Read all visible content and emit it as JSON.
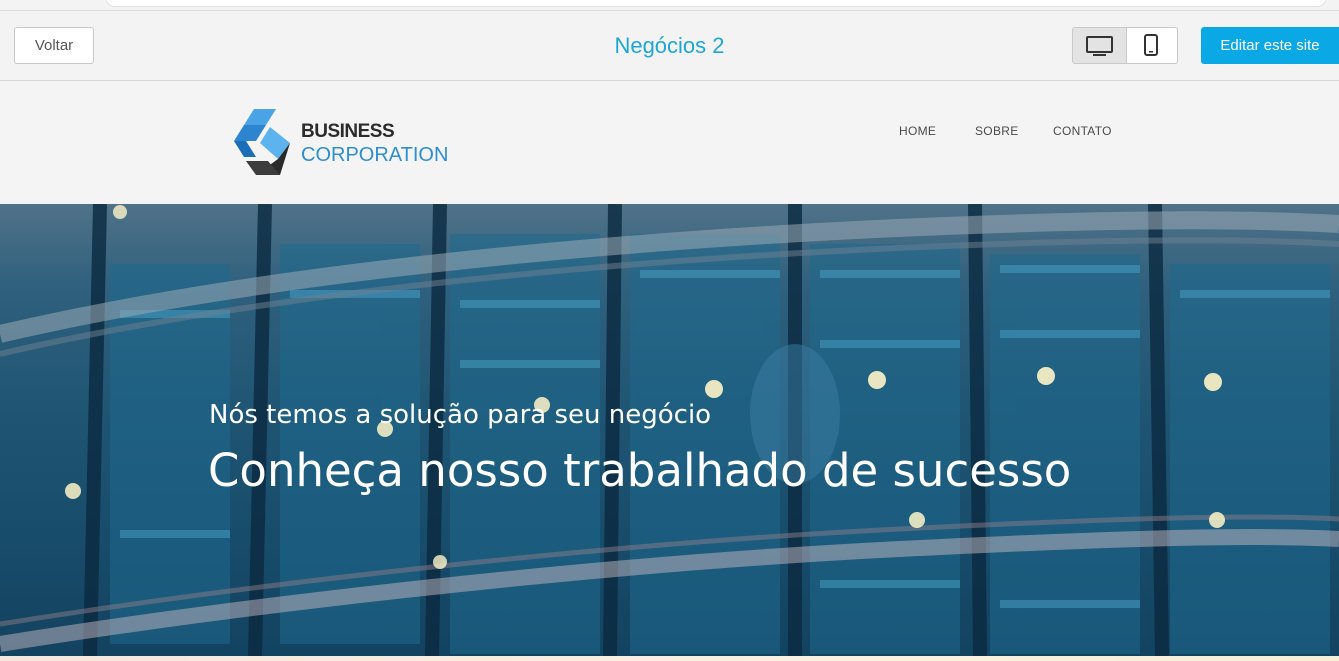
{
  "toolbar": {
    "back_label": "Voltar",
    "site_title": "Negócios 2",
    "devices": [
      "desktop-icon",
      "mobile-icon"
    ],
    "selected_device": "desktop",
    "edit_label": "Editar este site",
    "accent_color": "#1ea7d6",
    "button_color": "#0aa9e6"
  },
  "site": {
    "logo": {
      "line1": "BUSINESS",
      "line2": "CORPORATION"
    },
    "nav": [
      "HOME",
      "SOBRE",
      "CONTATO"
    ]
  },
  "hero": {
    "subtitle": "Nós temos a solução para seu negócio",
    "title": "Conheça nosso trabalhado de sucesso"
  }
}
